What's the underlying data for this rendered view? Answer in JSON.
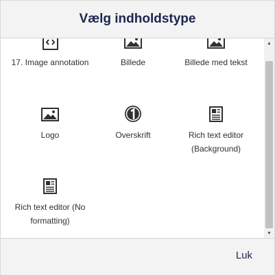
{
  "dialog": {
    "title": "Vælg indholdstype",
    "close_label": "Luk"
  },
  "items": [
    {
      "label": "17. Image annotation",
      "icon": "code-file-icon"
    },
    {
      "label": "Billede",
      "icon": "image-icon"
    },
    {
      "label": "Billede med tekst",
      "icon": "image-icon"
    },
    {
      "label": "Logo",
      "icon": "image-icon"
    },
    {
      "label": "Overskrift",
      "icon": "number-one-icon"
    },
    {
      "label": "Rich text editor (Background)",
      "icon": "document-icon"
    },
    {
      "label": "Rich text editor (No formatting)",
      "icon": "document-icon"
    }
  ],
  "colors": {
    "title": "#1b264f",
    "text": "#303033",
    "icon": "#303033",
    "header_bg": "#f3f3f3",
    "scroll_thumb": "#c1c1c1"
  }
}
